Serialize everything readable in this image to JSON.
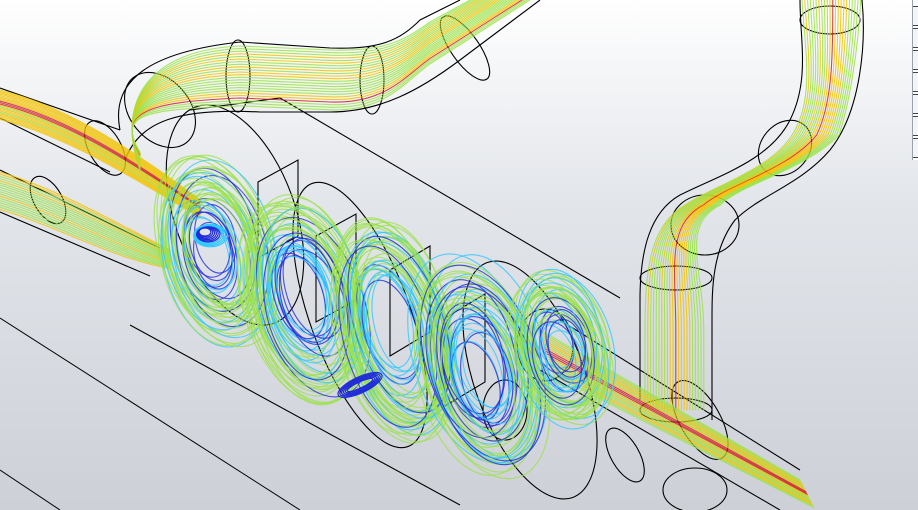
{
  "viewport": {
    "title": "",
    "background_top": "#ffffff",
    "background_bottom": "#cfd2d9"
  },
  "toolbar": {
    "buttons": [
      {
        "icon": "toolbar-button-1-icon"
      },
      {
        "icon": "toolbar-button-2-icon"
      },
      {
        "icon": "toolbar-button-3-icon"
      },
      {
        "icon": "toolbar-button-4-icon"
      },
      {
        "icon": "toolbar-button-5-icon"
      },
      {
        "icon": "toolbar-button-6-icon"
      },
      {
        "icon": "toolbar-button-7-icon"
      }
    ]
  },
  "colors": {
    "flow_high": "#d0202a",
    "flow_mid_high": "#f2c300",
    "flow_mid": "#9be24a",
    "flow_mid_low": "#30c8ff",
    "flow_low": "#1f2bd9",
    "geometry_edge": "#000000"
  }
}
